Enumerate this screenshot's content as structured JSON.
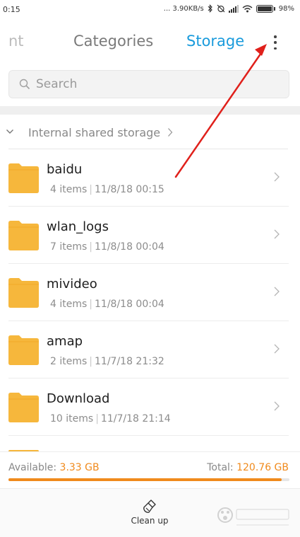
{
  "status_bar": {
    "time": "0:15",
    "network_speed": "... 3.90KB/s",
    "battery_percent": "98%",
    "icons": [
      "bluetooth-icon",
      "alarm-off-icon",
      "signal-icon",
      "wifi-icon",
      "battery-icon"
    ]
  },
  "tabs": {
    "partial_label": "nt",
    "categories_label": "Categories",
    "storage_label": "Storage",
    "active": "Storage"
  },
  "search": {
    "placeholder": "Search"
  },
  "breadcrumb": {
    "label": "Internal shared storage"
  },
  "files": [
    {
      "name": "baidu",
      "count": "4 items",
      "date": "11/8/18 00:15"
    },
    {
      "name": "wlan_logs",
      "count": "7 items",
      "date": "11/8/18 00:04"
    },
    {
      "name": "mivideo",
      "count": "4 items",
      "date": "11/8/18 00:04"
    },
    {
      "name": "amap",
      "count": "2 items",
      "date": "11/7/18 21:32"
    },
    {
      "name": "Download",
      "count": "10 items",
      "date": "11/7/18 21:14"
    }
  ],
  "storage": {
    "available_label": "Available:",
    "available_value": "3.33 GB",
    "total_label": "Total:",
    "total_value": "120.76 GB",
    "used_fraction": 0.972
  },
  "bottom": {
    "cleanup_label": "Clean up"
  },
  "colors": {
    "accent_blue": "#1a9bdc",
    "accent_orange": "#f08a1c",
    "folder_yellow": "#f6b73c",
    "annotation_red": "#e0201b"
  }
}
